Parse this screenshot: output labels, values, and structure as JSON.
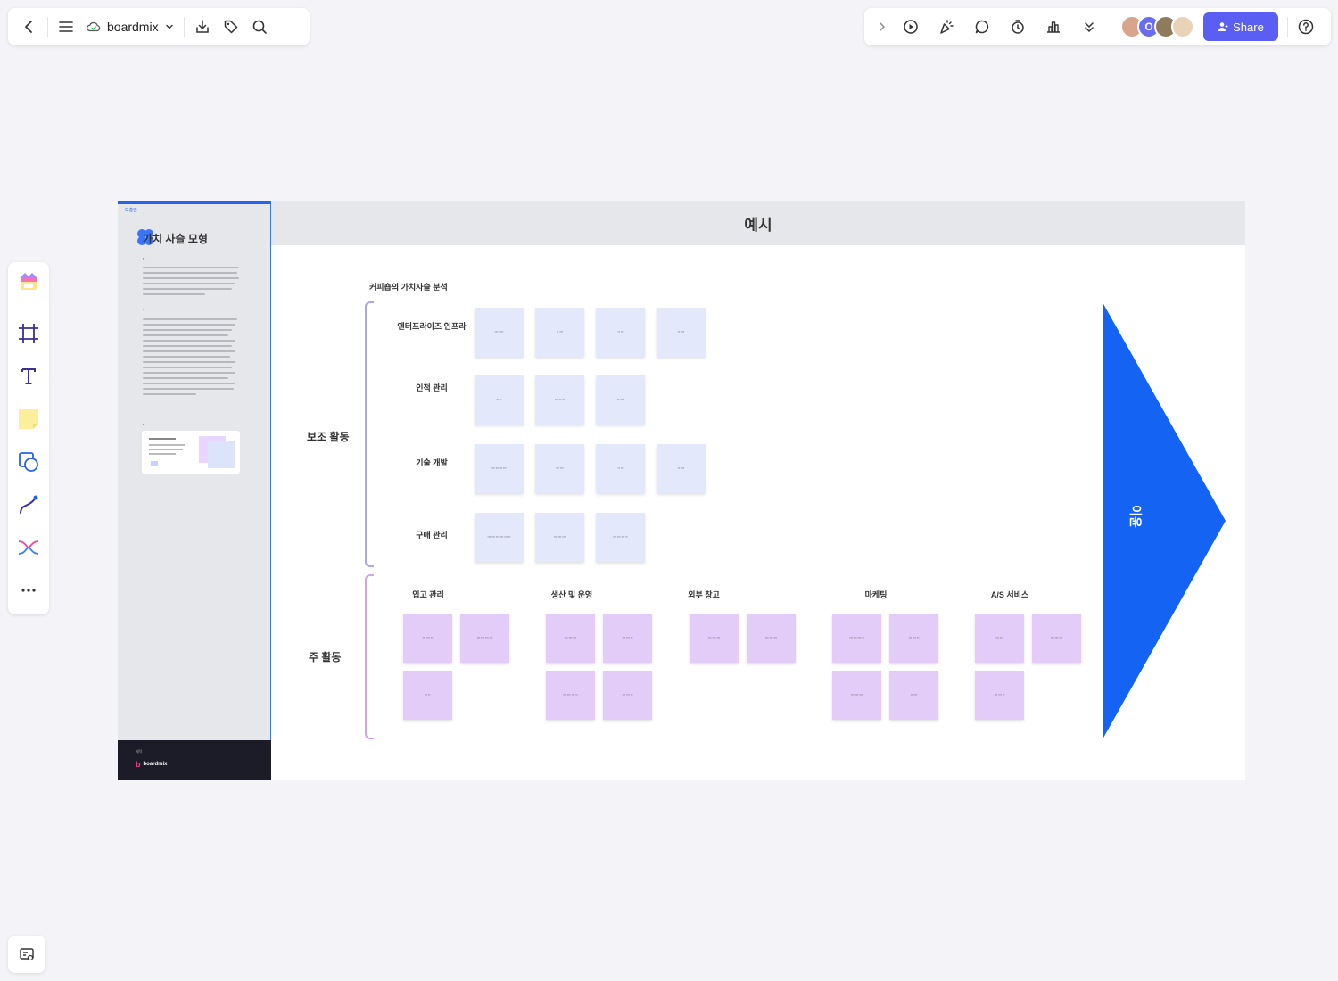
{
  "toolbar_left": {
    "app_name": "boardmix",
    "icons": [
      "back-icon",
      "menu-icon",
      "cloud-icon",
      "chevron-down-icon",
      "download-icon",
      "tag-icon",
      "search-icon"
    ]
  },
  "toolbar_right": {
    "share_label": "Share",
    "avatar_initial": "O",
    "icons": [
      "expand-icon",
      "play-icon",
      "celebrate-icon",
      "comment-icon",
      "timer-icon",
      "vote-icon",
      "more-down-icon",
      "help-icon"
    ]
  },
  "side_tools": [
    "template-icon",
    "frame-icon",
    "text-icon",
    "sticky-note-icon",
    "shape-icon",
    "connector-icon",
    "mindmap-icon",
    "more-icon"
  ],
  "board": {
    "header": "예시",
    "title": "커피숍의 가치사슬 분석",
    "support_label": "보조 활동",
    "primary_label": "주 활동",
    "margin_label": "이윤",
    "support_rows": [
      {
        "label": "엔터프라이즈 인프라",
        "notes": [
          "",
          "",
          "",
          ""
        ]
      },
      {
        "label": "인적 관리",
        "notes": [
          "",
          "",
          ""
        ]
      },
      {
        "label": "기술 개발",
        "notes": [
          "",
          "",
          "",
          ""
        ]
      },
      {
        "label": "구매 관리",
        "notes": [
          "",
          "",
          ""
        ]
      }
    ],
    "primary_cols": [
      {
        "label": "입고 관리"
      },
      {
        "label": "생산 및 운영"
      },
      {
        "label": "외부 창고"
      },
      {
        "label": "마케팅"
      },
      {
        "label": "A/S 서비스"
      }
    ],
    "left_panel": {
      "tag": "보충안",
      "title": "가치 사슬 모형",
      "footer_label": "제작",
      "footer_brand": "boardmix"
    }
  }
}
